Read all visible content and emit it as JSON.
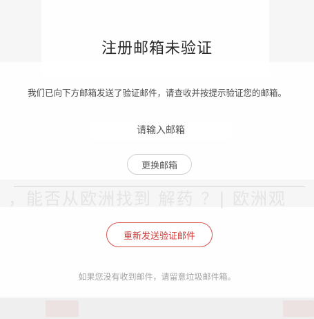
{
  "modal": {
    "title": "注册邮箱未验证",
    "message": "我们已向下方邮箱发送了验证邮件，请查收并按提示验证您的邮箱。",
    "email_placeholder": "请输入邮箱",
    "change_email_label": "更换邮箱",
    "resend_label": "重新发送验证邮件",
    "hint": "如果您没有收到邮件，请留意垃圾邮件箱。"
  },
  "background": {
    "ticker_text": "，能否从欧洲找到 解药 ？| 欧洲观"
  },
  "colors": {
    "accent": "#d9534f",
    "text": "#2b2b2b",
    "muted": "#a3a3a3"
  }
}
